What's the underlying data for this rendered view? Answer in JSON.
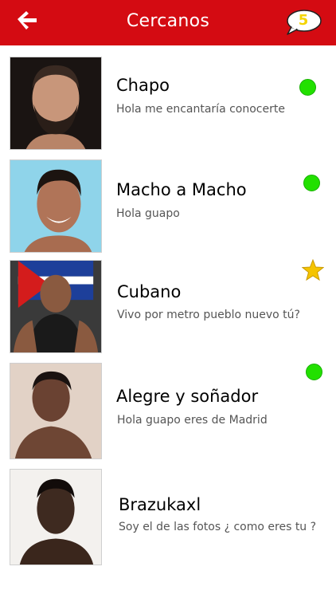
{
  "header": {
    "title": "Cercanos",
    "unread_count": "5",
    "colors": {
      "bar": "#d40b12",
      "badge_text": "#f4d400"
    }
  },
  "contacts": [
    {
      "name": "Chapo",
      "message": "Hola me encantaría conocerte",
      "status": "online"
    },
    {
      "name": "Macho a Macho",
      "message": "Hola guapo",
      "status": "online"
    },
    {
      "name": "Cubano",
      "message": "Vivo por metro pueblo nuevo tú?",
      "status": "favorite"
    },
    {
      "name": "Alegre y soñador",
      "message": "Hola guapo eres de Madrid",
      "status": "online"
    },
    {
      "name": "Brazukaxl",
      "message": "Soy el de las fotos ¿ como eres tu ?",
      "status": "none"
    }
  ],
  "icons": {
    "back": "arrow-left-icon",
    "messages": "speech-bubble-icon",
    "online": "online-dot-icon",
    "favorite": "star-icon"
  },
  "colors": {
    "online": "#22e000",
    "star": "#f5c400"
  }
}
